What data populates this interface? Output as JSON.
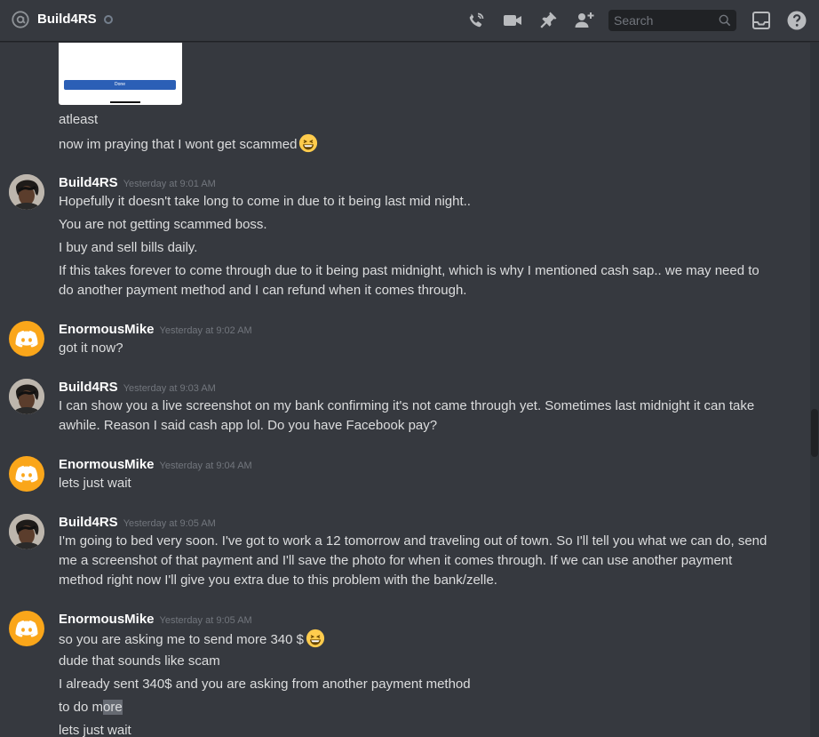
{
  "header": {
    "channel_name": "Build4RS",
    "search_placeholder": "Search"
  },
  "attachment": {
    "button_label": "Done"
  },
  "messages": [
    {
      "lines": [
        "atleast",
        "now im praying that I wont get scammed"
      ]
    },
    {
      "author": "Build4RS",
      "timestamp": "Yesterday at 9:01 AM",
      "lines": [
        "Hopefully it doesn't take long to come in due to it being last mid night..",
        "You are not getting scammed boss.",
        "I buy and sell bills daily.",
        "If this takes forever to come through due to it being past midnight, which is why I mentioned cash sap.. we may need to do another payment method and I can refund when it comes through."
      ]
    },
    {
      "author": "EnormousMike",
      "timestamp": "Yesterday at 9:02 AM",
      "lines": [
        "got it now?"
      ]
    },
    {
      "author": "Build4RS",
      "timestamp": "Yesterday at 9:03 AM",
      "lines": [
        "I can show you a live screenshot on my bank confirming it's not came through yet. Sometimes last midnight it can take awhile. Reason I said cash app lol. Do you have Facebook pay?"
      ]
    },
    {
      "author": "EnormousMike",
      "timestamp": "Yesterday at 9:04 AM",
      "lines": [
        "lets just wait"
      ]
    },
    {
      "author": "Build4RS",
      "timestamp": "Yesterday at 9:05 AM",
      "lines": [
        "I'm going to bed very soon. I've got to work a 12 tomorrow and traveling out of town. So I'll tell you what we can do, send me a screenshot of that payment and I'll save the photo for when it comes through. If we can use another payment method right now I'll give you extra due to this problem with the bank/zelle."
      ]
    },
    {
      "author": "EnormousMike",
      "timestamp": "Yesterday at 9:05 AM",
      "lines": [
        "so you are asking me to send more 340 $",
        "dude that sounds like scam",
        "I already sent 340$ and you are asking from another payment method",
        "to do m",
        "ore",
        "lets just wait"
      ]
    }
  ],
  "colors": {
    "background": "#36393f",
    "discord_avatar": "#faa61a",
    "link_blue": "#2b5fb6"
  }
}
